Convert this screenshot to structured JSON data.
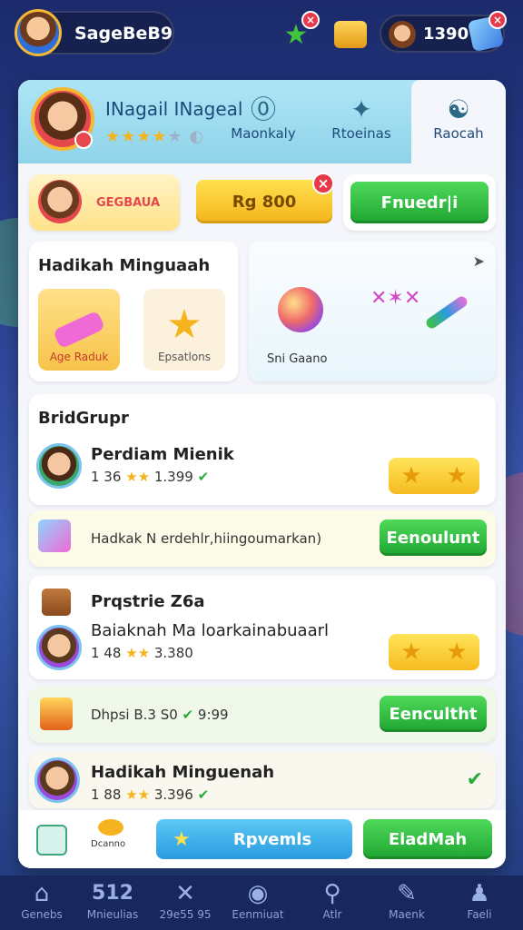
{
  "topbar": {
    "player_name": "SageBeB9",
    "coins": "1390",
    "badge": "×"
  },
  "header": {
    "title": "INagail INageal",
    "stars": "★★★★",
    "stars_dim": "★",
    "tabs": [
      {
        "label": "Maonkaly",
        "icon": "⓪"
      },
      {
        "label": "Rtoeinas",
        "icon": "✦"
      },
      {
        "label": "Raocah",
        "icon": "☯"
      }
    ]
  },
  "promo_row": {
    "banner_label": "GEGBAUA",
    "price_button": "Rg 800",
    "friend_button": "Fnuedr|i",
    "close": "×"
  },
  "section1": {
    "title": "Hadikah Minguaah",
    "tiles": [
      {
        "label": "Age Raduk"
      },
      {
        "label": "Epsatlons"
      }
    ],
    "right_label": "Sni Gaano"
  },
  "group": {
    "title": "BridGrupr",
    "items": [
      {
        "name": "Perdiam Mienik",
        "stat1": "1 36",
        "stat2": "1.399"
      }
    ]
  },
  "banner1": {
    "text": "Hadkak  N erdehlr,hiingoumarkan)",
    "button": "Eenoulunt"
  },
  "section3": {
    "title": "Prqstrie Z6a",
    "item_name": "Baiaknah Ma loarkainabuaarl",
    "stat1": "1 48",
    "stat2": "3.380"
  },
  "banner2": {
    "text": "Dhpsi  B.3 S0",
    "text2": "9:99",
    "button": "Eencultht"
  },
  "section4": {
    "title": "Hadikah  Minguenah",
    "stat1": "1 88",
    "stat2": "3.396"
  },
  "action_row": {
    "small_label": "Dcanno",
    "blue_button": "Rpvemls",
    "green_button": "EladMah"
  },
  "nav": [
    {
      "label": "Genebs",
      "icon": "⌂"
    },
    {
      "label": "Mnieulias",
      "icon": "512"
    },
    {
      "label": "29e55 95",
      "icon": "✕"
    },
    {
      "label": "Eenmiuat",
      "icon": "◉"
    },
    {
      "label": "Atlr",
      "icon": "⚲"
    },
    {
      "label": "Maenk",
      "icon": "✎"
    },
    {
      "label": "Faeli",
      "icon": "♟"
    }
  ]
}
